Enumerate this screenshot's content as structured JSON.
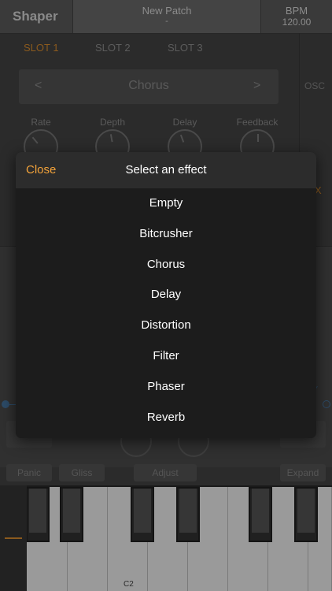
{
  "header": {
    "title": "Shaper",
    "patch_name": "New Patch",
    "patch_sub": "-",
    "bpm_label": "BPM",
    "bpm_value": "120.00"
  },
  "slots": [
    {
      "label": "SLOT 1"
    },
    {
      "label": "SLOT 2"
    },
    {
      "label": "SLOT 3"
    }
  ],
  "side": {
    "osc_label": "OSC",
    "x_label": "X"
  },
  "effect_selector": {
    "prev": "<",
    "current": "Chorus",
    "next": ">"
  },
  "knobs": [
    {
      "label": "Rate"
    },
    {
      "label": "Depth"
    },
    {
      "label": "Delay"
    },
    {
      "label": "Feedback"
    }
  ],
  "bottom_buttons": {
    "panic": "Panic",
    "gliss": "Gliss",
    "adjust": "Adjust",
    "expand": "Expand"
  },
  "keyboard": {
    "c2_label": "C2"
  },
  "modal": {
    "close_label": "Close",
    "title": "Select an effect",
    "items": [
      "Empty",
      "Bitcrusher",
      "Chorus",
      "Delay",
      "Distortion",
      "Filter",
      "Phaser",
      "Reverb"
    ]
  },
  "colors": {
    "accent": "#f2a23a",
    "accent_dim": "#8b5a1e",
    "link_blue": "#2c4a66"
  }
}
